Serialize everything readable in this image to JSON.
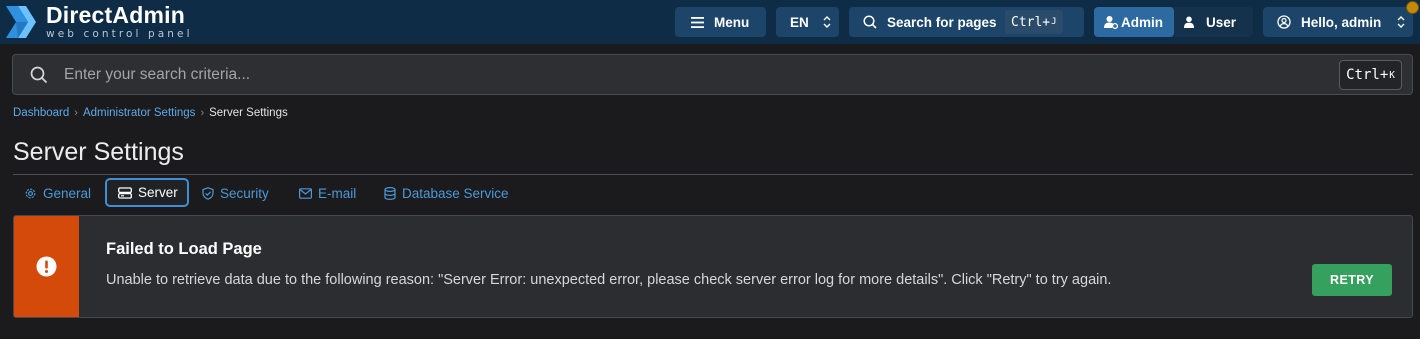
{
  "brand": {
    "title": "DirectAdmin",
    "subtitle": "web control panel"
  },
  "topbar": {
    "menu_label": "Menu",
    "language": "EN",
    "search_label": "Search for pages",
    "search_shortcut_main": "Ctrl+",
    "search_shortcut_key": "J",
    "role_admin": "Admin",
    "role_user": "User",
    "greeting": "Hello, admin"
  },
  "search": {
    "placeholder": "Enter your search criteria...",
    "shortcut_main": "Ctrl+",
    "shortcut_key": "K"
  },
  "breadcrumb": [
    "Dashboard",
    "Administrator Settings",
    "Server Settings"
  ],
  "page_title": "Server Settings",
  "tabs": [
    {
      "label": "General",
      "icon": "gear-icon"
    },
    {
      "label": "Server",
      "icon": "server-icon",
      "active": true
    },
    {
      "label": "Security",
      "icon": "shield-icon"
    },
    {
      "label": "E-mail",
      "icon": "envelope-icon"
    },
    {
      "label": "Database Service",
      "icon": "database-icon"
    }
  ],
  "error": {
    "title": "Failed to Load Page",
    "message": "Unable to retrieve data due to the following reason: \"Server Error: unexpected error, please check server error log for more details\". Click \"Retry\" to try again.",
    "retry_label": "RETRY",
    "icon": "alert-circle-icon"
  },
  "colors": {
    "topbar_bg": "#0f2c46",
    "button_bg": "#1c4569",
    "accent": "#3f8fd6",
    "link": "#5ea9e8",
    "error_accent": "#d44a0b",
    "retry_bg": "#36a05e"
  }
}
